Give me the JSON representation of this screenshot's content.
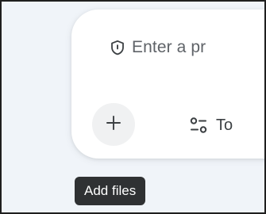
{
  "composer": {
    "prompt_placeholder": "Enter a pr",
    "add_files_icon": "plus-icon",
    "tools_icon": "tools-sliders-icon",
    "tools_label": "To",
    "shield_icon": "shield-icon"
  },
  "tooltip": {
    "text": "Add files"
  },
  "colors": {
    "background": "#f0f4f9",
    "card": "#ffffff",
    "text_secondary": "#5f6368",
    "tooltip_bg": "#2f3133"
  }
}
